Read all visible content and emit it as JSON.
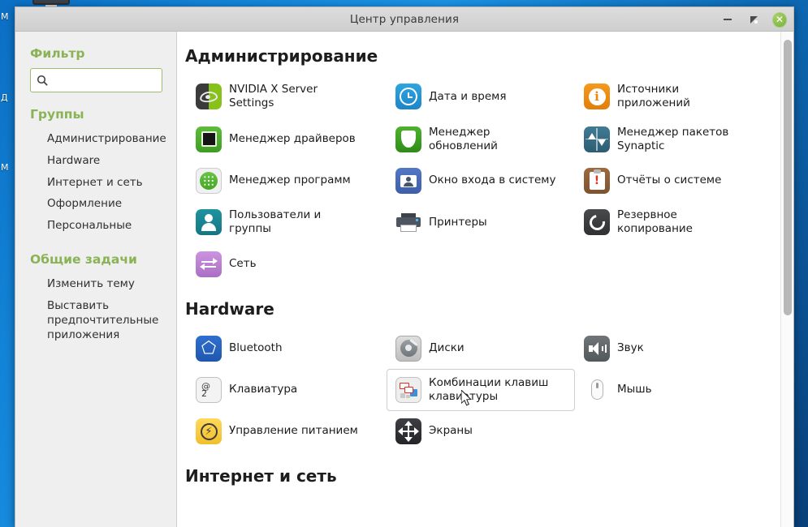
{
  "desktop": {
    "icon_monitor": "monitor-icon",
    "partial_labels": [
      "М",
      "Д",
      "М"
    ]
  },
  "window": {
    "title": "Центр управления",
    "buttons": {
      "minimize": "minimize-button",
      "maximize": "maximize-button",
      "close": "✕"
    }
  },
  "sidebar": {
    "filter_heading": "Фильтр",
    "search": {
      "value": "",
      "placeholder": ""
    },
    "groups_heading": "Группы",
    "groups": [
      {
        "label": "Администрирование"
      },
      {
        "label": "Hardware"
      },
      {
        "label": "Интернет и сеть"
      },
      {
        "label": "Оформление"
      },
      {
        "label": "Персональные"
      }
    ],
    "common_tasks_heading": "Общие задачи",
    "common_tasks": [
      {
        "label": "Изменить тему"
      },
      {
        "label": "Выставить предпочтительные приложения"
      }
    ]
  },
  "content": {
    "sections": [
      {
        "title": "Администрирование",
        "items": [
          {
            "label": "NVIDIA X Server Settings",
            "icon": "nvidia-icon",
            "hover": false
          },
          {
            "label": "Дата и время",
            "icon": "clock-icon",
            "hover": false
          },
          {
            "label": "Источники приложений",
            "icon": "info-circle-icon",
            "hover": false
          },
          {
            "label": "Менеджер драйверов",
            "icon": "driver-manager-icon",
            "hover": false
          },
          {
            "label": "Менеджер обновлений",
            "icon": "shield-icon",
            "hover": false
          },
          {
            "label": "Менеджер пакетов Synaptic",
            "icon": "synaptic-icon",
            "hover": false
          },
          {
            "label": "Менеджер программ",
            "icon": "software-manager-icon",
            "hover": false
          },
          {
            "label": "Окно входа в систему",
            "icon": "login-window-icon",
            "hover": false
          },
          {
            "label": "Отчёты о системе",
            "icon": "system-reports-icon",
            "hover": false
          },
          {
            "label": "Пользователи и группы",
            "icon": "users-icon",
            "hover": false
          },
          {
            "label": "Принтеры",
            "icon": "printer-icon",
            "hover": false
          },
          {
            "label": "Резервное копирование",
            "icon": "backup-icon",
            "hover": false
          },
          {
            "label": "Сеть",
            "icon": "network-icon",
            "hover": false
          }
        ]
      },
      {
        "title": "Hardware",
        "items": [
          {
            "label": "Bluetooth",
            "icon": "bluetooth-icon",
            "hover": false
          },
          {
            "label": "Диски",
            "icon": "disks-icon",
            "hover": false
          },
          {
            "label": "Звук",
            "icon": "sound-icon",
            "hover": false
          },
          {
            "label": "Клавиатура",
            "icon": "keyboard-icon",
            "hover": false
          },
          {
            "label": "Комбинации клавиш клавиатуры",
            "icon": "keyboard-shortcuts-icon",
            "hover": true
          },
          {
            "label": "Мышь",
            "icon": "mouse-icon",
            "hover": false
          },
          {
            "label": "Управление питанием",
            "icon": "power-icon",
            "hover": false
          },
          {
            "label": "Экраны",
            "icon": "displays-icon",
            "hover": false
          }
        ]
      },
      {
        "title": "Интернет и сеть",
        "items": []
      }
    ]
  },
  "scrollbar": {
    "position": "top"
  },
  "colors": {
    "accent_green": "#8ab356",
    "titlebar": "#d5d5d5",
    "sidebar_bg": "#efefef",
    "content_bg": "#ffffff",
    "desktop_blue": "#1283d6"
  }
}
